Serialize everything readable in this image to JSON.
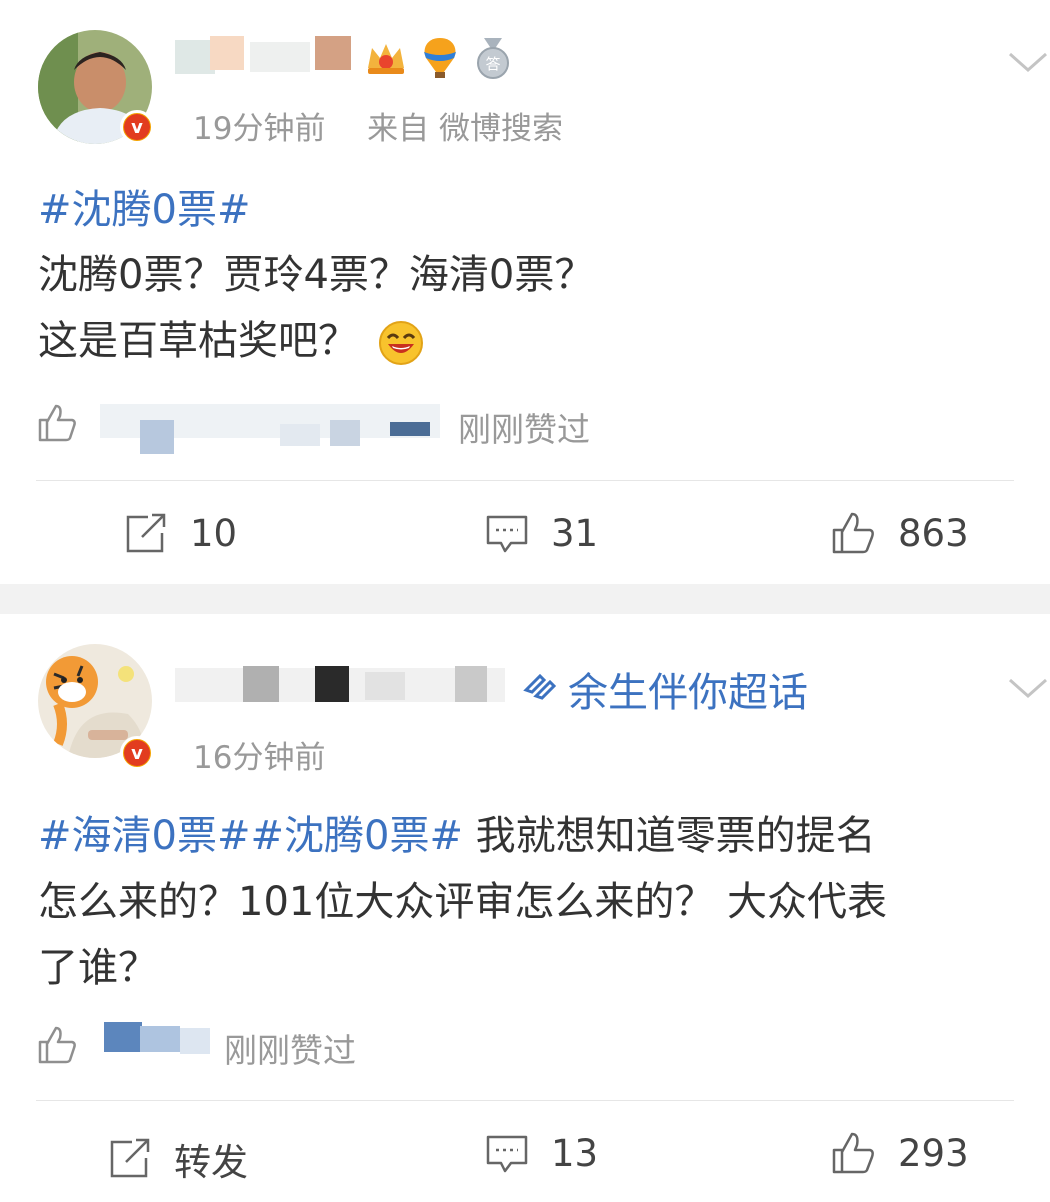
{
  "post1": {
    "time": "19分钟前",
    "source": "来自 微博搜索",
    "hashtag": "#沈腾0票#",
    "line1": "沈腾0票？贾玲4票？海清0票？",
    "line2": "这是百草枯奖吧？",
    "liked_by_suffix": "刚刚赞过",
    "actions": {
      "repost": "10",
      "comment": "31",
      "like": "863"
    }
  },
  "post2": {
    "supertopic": "余生伴你超话",
    "time": "16分钟前",
    "hashtag": "#海清0票##沈腾0票#",
    "line1_rest": " 我就想知道零票的提名",
    "line2": "怎么来的？101位大众评审怎么来的？ 大众代表",
    "line3": "了谁？",
    "liked_by_suffix": "刚刚赞过",
    "actions": {
      "repost": "转发",
      "comment": "13",
      "like": "293"
    }
  },
  "colors": {
    "link": "#3c72c0",
    "meta": "#999999",
    "separator": "#f2f2f2"
  }
}
